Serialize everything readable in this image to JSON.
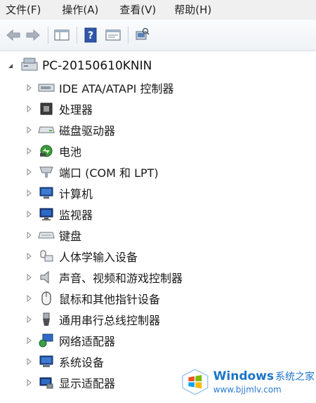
{
  "menu": {
    "file": "文件(F)",
    "action": "操作(A)",
    "view": "查看(V)",
    "help": "帮助(H)"
  },
  "toolbar": {
    "icons": [
      "back-arrow-icon",
      "forward-arrow-icon",
      "show-hide-console-tree-icon",
      "help-icon",
      "properties-icon",
      "scan-hardware-icon"
    ]
  },
  "tree": {
    "root_label": "PC-20150610KNIN",
    "items": [
      {
        "label": "IDE ATA/ATAPI 控制器",
        "icon": "ide-controller-icon"
      },
      {
        "label": "处理器",
        "icon": "processor-icon"
      },
      {
        "label": "磁盘驱动器",
        "icon": "disk-drive-icon"
      },
      {
        "label": "电池",
        "icon": "battery-icon"
      },
      {
        "label": "端口 (COM 和 LPT)",
        "icon": "port-icon"
      },
      {
        "label": "计算机",
        "icon": "computer-icon"
      },
      {
        "label": "监视器",
        "icon": "monitor-icon"
      },
      {
        "label": "键盘",
        "icon": "keyboard-icon"
      },
      {
        "label": "人体学输入设备",
        "icon": "hid-icon"
      },
      {
        "label": "声音、视频和游戏控制器",
        "icon": "sound-icon"
      },
      {
        "label": "鼠标和其他指针设备",
        "icon": "mouse-icon"
      },
      {
        "label": "通用串行总线控制器",
        "icon": "usb-icon"
      },
      {
        "label": "网络适配器",
        "icon": "network-adapter-icon"
      },
      {
        "label": "系统设备",
        "icon": "system-device-icon"
      },
      {
        "label": "显示适配器",
        "icon": "display-adapter-icon"
      }
    ]
  },
  "watermark": {
    "brand": "Windows",
    "brand_zh": "系统之家",
    "url": "www.bjjmlv.com"
  },
  "colors": {
    "menubar_bg": "#f0f0f0",
    "watermark_blue": "#1b74c9"
  }
}
